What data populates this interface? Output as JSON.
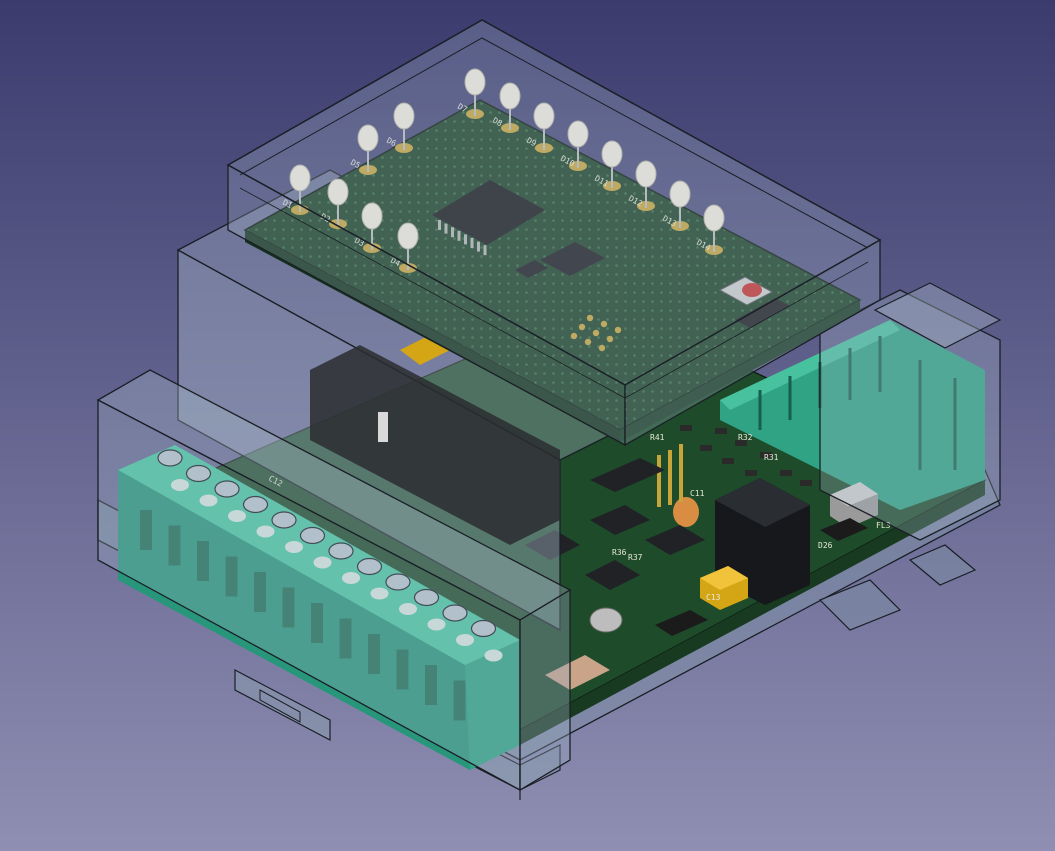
{
  "viewport": {
    "background_top": "#3b3b6e",
    "background_bottom": "#8f8fb3"
  },
  "assembly": {
    "enclosure_color": "#9fb4c4",
    "enclosure_edge": "#1a1f26",
    "pcb_color": "#1f4a2a",
    "terminal_color": "#2fa383",
    "led_color": "#f1ece0",
    "button_color": "#c8322e",
    "jumper_color": "#d4a514",
    "capacitor_color": "#d88d42"
  },
  "silkscreen": {
    "top_board": [
      "D1",
      "D2",
      "D3",
      "D4",
      "D5",
      "D6",
      "D7",
      "D8",
      "D9",
      "D10",
      "D11",
      "D12",
      "D13",
      "D14"
    ],
    "main_board": [
      "C12",
      "R36",
      "R37",
      "D26",
      "FL3",
      "C13",
      "C11",
      "R32",
      "R31",
      "R41"
    ]
  },
  "icons": {
    "scene": "enclosure-3d-model",
    "leds": "led-component",
    "ic": "ic-chip",
    "terminal": "screw-terminal",
    "button": "push-button"
  }
}
